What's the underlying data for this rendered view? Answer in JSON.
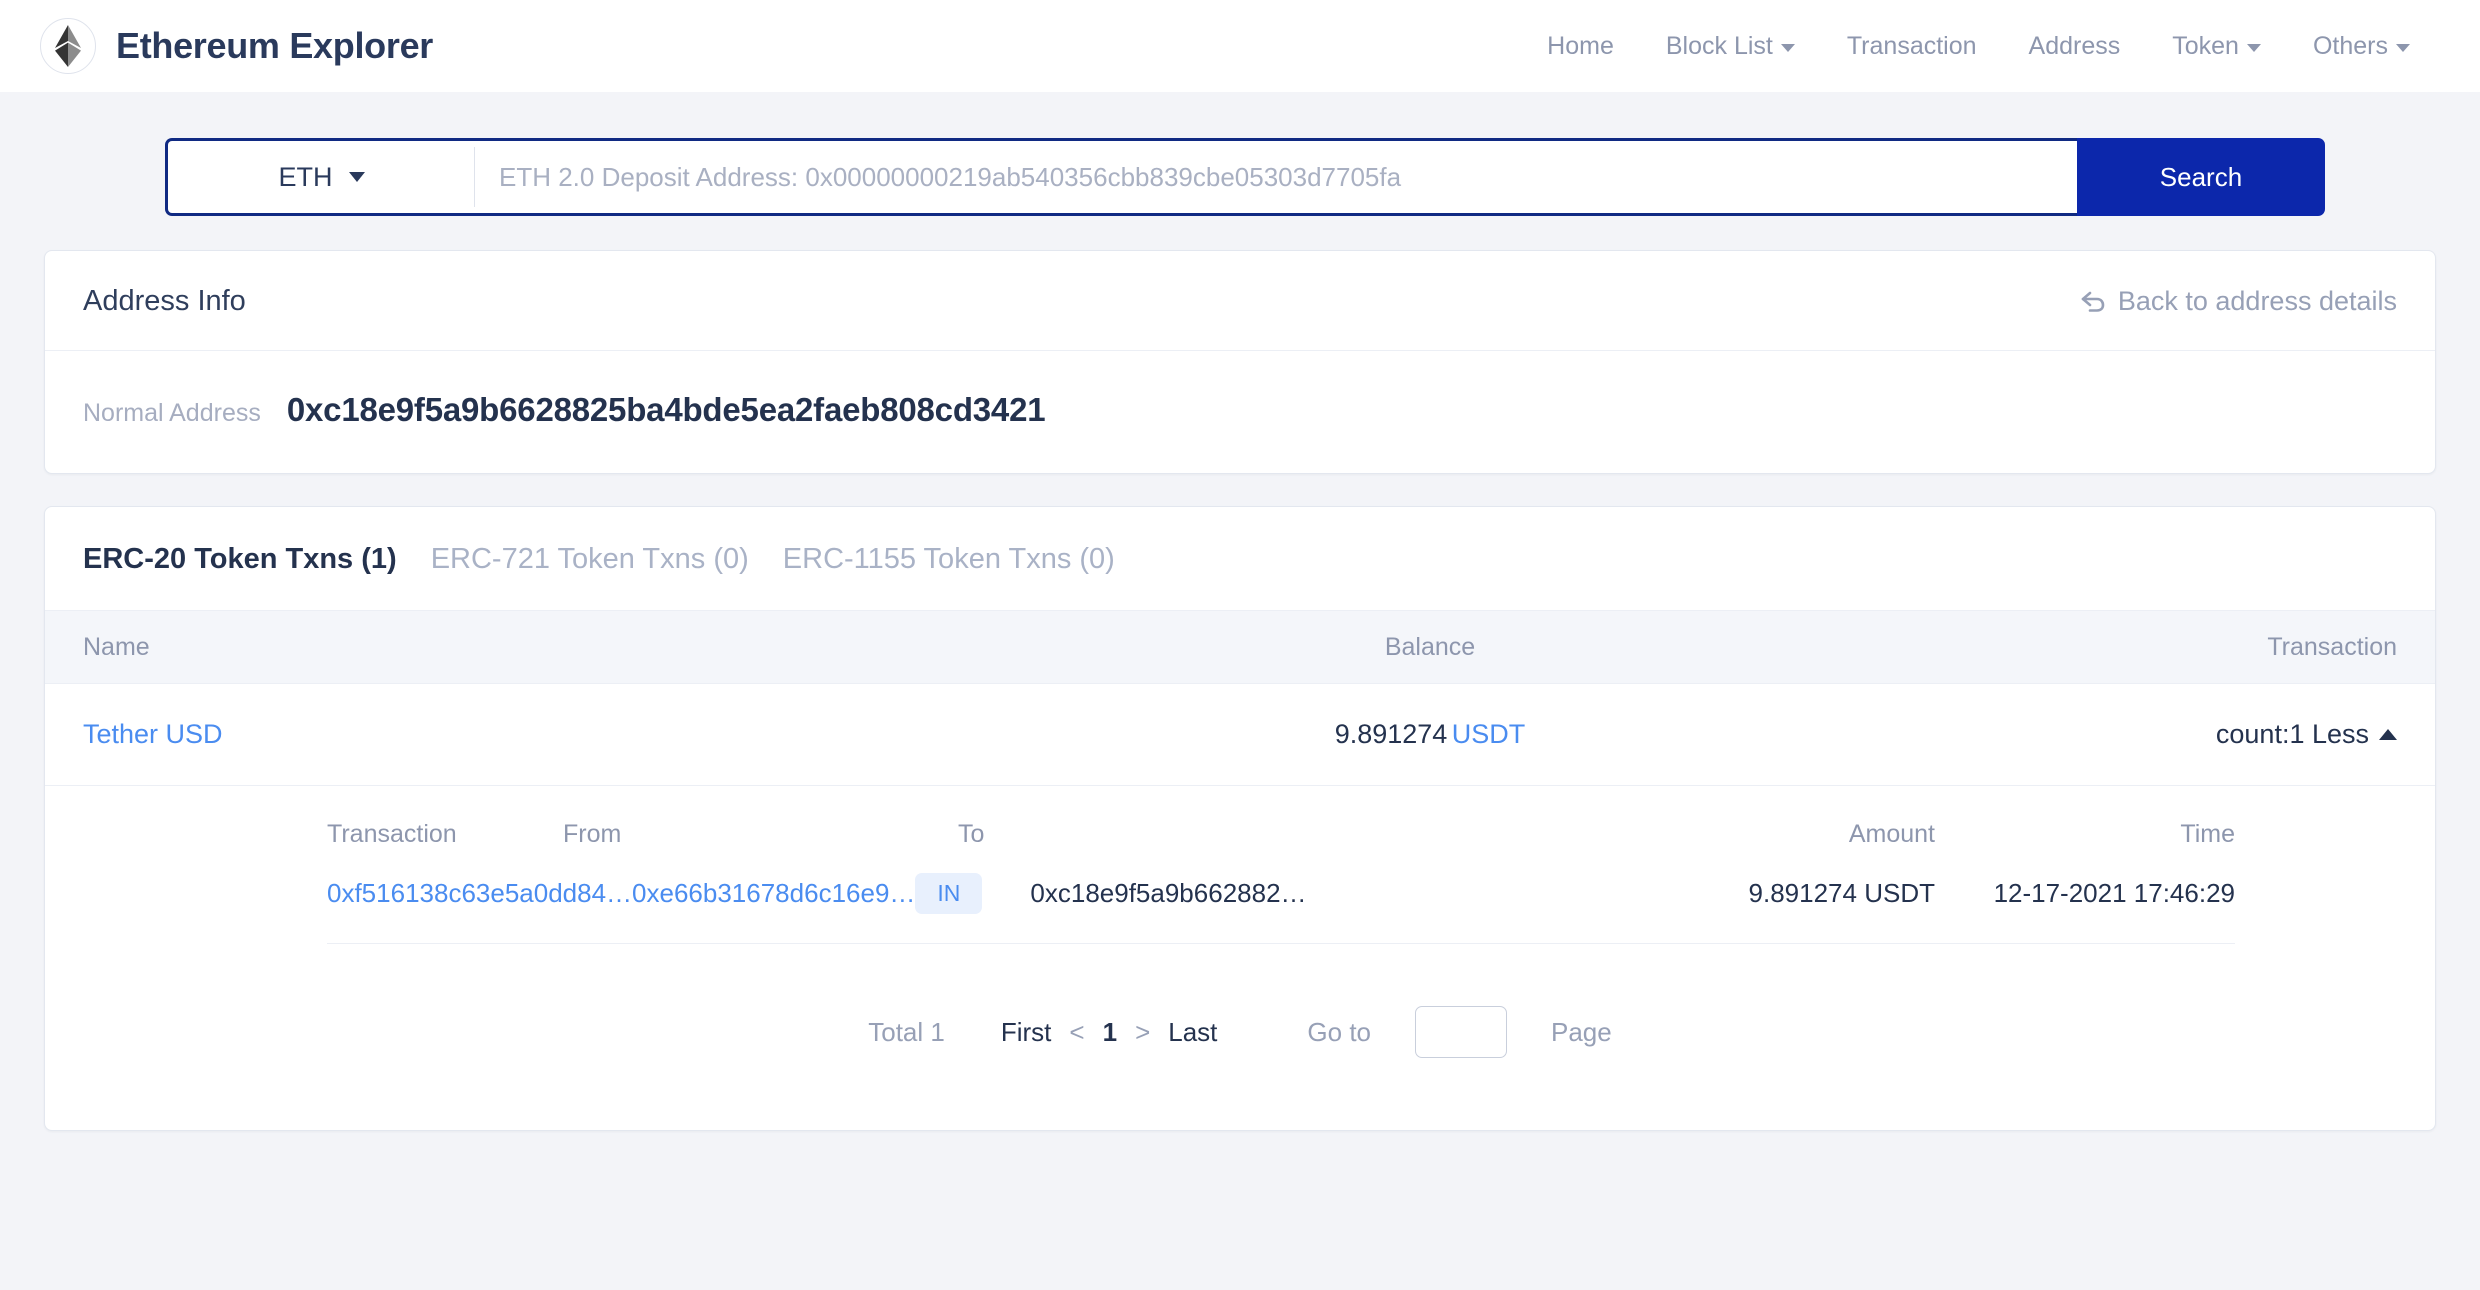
{
  "header": {
    "logo_icon": "ethereum-diamond-icon",
    "title": "Ethereum Explorer",
    "nav": [
      {
        "label": "Home",
        "has_caret": false
      },
      {
        "label": "Block List",
        "has_caret": true
      },
      {
        "label": "Transaction",
        "has_caret": false
      },
      {
        "label": "Address",
        "has_caret": false
      },
      {
        "label": "Token",
        "has_caret": true
      },
      {
        "label": "Others",
        "has_caret": true
      }
    ]
  },
  "search": {
    "chain_selected": "ETH",
    "placeholder": "ETH 2.0 Deposit Address: 0x00000000219ab540356cbb839cbe05303d7705fa",
    "value": "",
    "button_label": "Search"
  },
  "address_info": {
    "title": "Address Info",
    "back_label": "Back to address details",
    "address_label": "Normal Address",
    "address_value": "0xc18e9f5a9b6628825ba4bde5ea2faeb808cd3421"
  },
  "token_txns": {
    "tabs": [
      {
        "label": "ERC-20 Token Txns (1)",
        "active": true
      },
      {
        "label": "ERC-721 Token Txns (0)",
        "active": false
      },
      {
        "label": "ERC-1155 Token Txns (0)",
        "active": false
      }
    ],
    "columns": {
      "name": "Name",
      "balance": "Balance",
      "transaction": "Transaction"
    },
    "row": {
      "name": "Tether USD",
      "balance_amount": "9.891274",
      "balance_unit": "USDT",
      "count_label": "count:1 Less",
      "expanded": true
    },
    "sub_columns": {
      "transaction": "Transaction",
      "from": "From",
      "to": "To",
      "amount": "Amount",
      "time": "Time"
    },
    "sub_rows": [
      {
        "tx_hash": "0xf516138c63e5a0dd84…",
        "from": "0xe66b31678d6c16e9…",
        "direction": "IN",
        "to": "0xc18e9f5a9b662882…",
        "amount": "9.891274",
        "amount_unit": "USDT",
        "time": "12-17-2021 17:46:29"
      }
    ]
  },
  "pagination": {
    "total": "Total 1",
    "first": "First",
    "prev": "<",
    "current_page": "1",
    "next": ">",
    "last": "Last",
    "goto_label": "Go to",
    "goto_value": "",
    "page_label": "Page"
  },
  "colors": {
    "accent_blue": "#0c27ab",
    "link_blue": "#4a8cf0",
    "text_dark": "#24324e",
    "text_muted": "#8d96ad",
    "page_bg": "#f3f4f8",
    "badge_in_bg": "#e8f0fd"
  }
}
